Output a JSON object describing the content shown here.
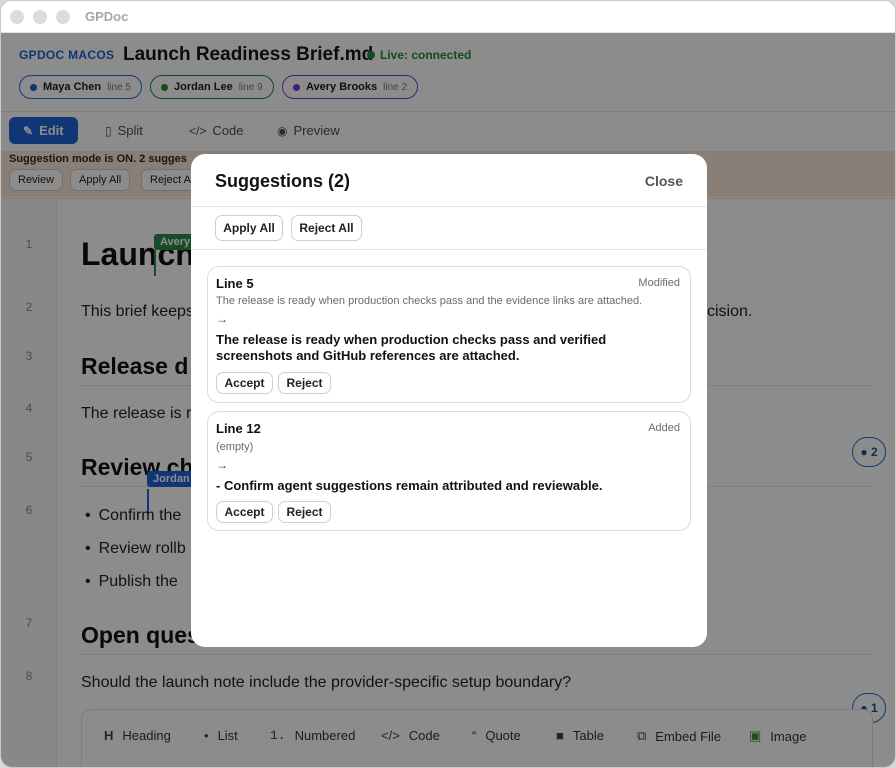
{
  "window": {
    "app_title": "GPDoc"
  },
  "header": {
    "brand": "GPDOC MACOS",
    "doc_title": "Launch Readiness Brief.md",
    "live_status": "Live: connected",
    "collaborators": [
      {
        "name": "Maya Chen",
        "line": "line 5",
        "color": "#1f5fd6"
      },
      {
        "name": "Jordan Lee",
        "line": "line 9",
        "color": "#1f8a3b"
      },
      {
        "name": "Avery Brooks",
        "line": "line 2",
        "color": "#7a3bd6"
      }
    ]
  },
  "tabs": [
    {
      "label": "Edit",
      "icon": "pencil-icon",
      "active": true
    },
    {
      "label": "Split",
      "icon": "split-icon"
    },
    {
      "label": "Code",
      "icon": "code-icon"
    },
    {
      "label": "Preview",
      "icon": "eye-icon"
    }
  ],
  "banner": {
    "text": "Suggestion mode is ON. 2 sugges",
    "buttons": [
      "Review",
      "Apply All",
      "Reject A"
    ]
  },
  "editor": {
    "line_numbers": [
      "1",
      "2",
      "3",
      "4",
      "5",
      "6",
      "7",
      "8"
    ],
    "lines": {
      "l1": "Launch",
      "l2_left": "This brief keeps",
      "l2_right": "cision.",
      "l3": "Release d",
      "l4": "The release is r",
      "l5": "Review ch",
      "l6_a": "Confirm the",
      "l6_b": "Review rollb",
      "l6_c": "Publish the",
      "l7": "Open ques",
      "l8": "Should the launch note include the provider-specific setup boundary?"
    },
    "cursors": {
      "avery": "Avery",
      "jordan": "Jordan"
    },
    "badges": [
      "2",
      "1"
    ]
  },
  "toolbar": [
    {
      "glyph": "H",
      "label": "Heading",
      "icon": "heading-icon"
    },
    {
      "glyph": "•",
      "label": "List",
      "icon": "list-icon"
    },
    {
      "glyph": "1.",
      "label": "Numbered",
      "icon": "numbered-list-icon"
    },
    {
      "glyph": "</>",
      "label": "Code",
      "icon": "code-icon"
    },
    {
      "glyph": "“",
      "label": "Quote",
      "icon": "quote-icon"
    },
    {
      "glyph": "■",
      "label": "Table",
      "icon": "table-icon"
    },
    {
      "glyph": "⧉",
      "label": "Embed File",
      "icon": "embed-file-icon"
    },
    {
      "glyph": "▣",
      "label": "Image",
      "icon": "image-icon"
    }
  ],
  "modal": {
    "title": "Suggestions (2)",
    "close": "Close",
    "apply_all": "Apply All",
    "reject_all": "Reject All",
    "suggestions": [
      {
        "line": "Line 5",
        "kind": "Modified",
        "old": "The release is ready when production checks pass and the evidence links are attached.",
        "arrow": "→",
        "new": "The release is ready when production checks pass and verified screenshots and GitHub references are attached.",
        "accept": "Accept",
        "reject": "Reject"
      },
      {
        "line": "Line 12",
        "kind": "Added",
        "old": "(empty)",
        "arrow": "→",
        "new": "- Confirm agent suggestions remain attributed and reviewable.",
        "accept": "Accept",
        "reject": "Reject"
      }
    ]
  }
}
